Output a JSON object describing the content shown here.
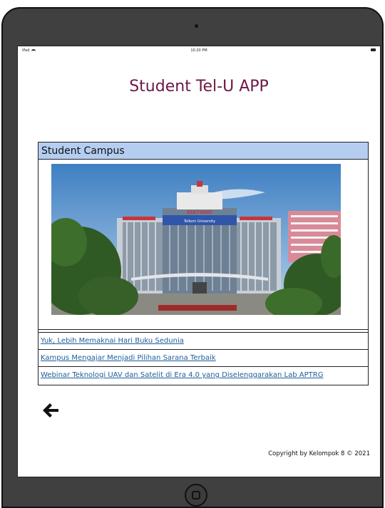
{
  "status": {
    "device": "iPad",
    "time": "10:20 PM"
  },
  "app": {
    "title": "Student Tel-U APP"
  },
  "panel": {
    "header": "Student Campus",
    "photo_sign": "REKTORAT",
    "photo_sub": "Telkom University"
  },
  "links": [
    "Yuk, Lebih Memaknai Hari Buku Sedunia",
    "Kampus Mengajar Menjadi Pilihan Sarana Terbaik",
    "Webinar Teknologi UAV dan Satelit di Era 4.0 yang Diselenggarakan Lab APTRG"
  ],
  "footer": {
    "copyright": "Copyright by Kelompok 8 © 2021"
  },
  "icons": {
    "back": "arrow-left-icon"
  },
  "colors": {
    "title": "#6e1747",
    "header_bg": "#b4cdf1",
    "link": "#1d5d9a",
    "frame": "#404040"
  }
}
